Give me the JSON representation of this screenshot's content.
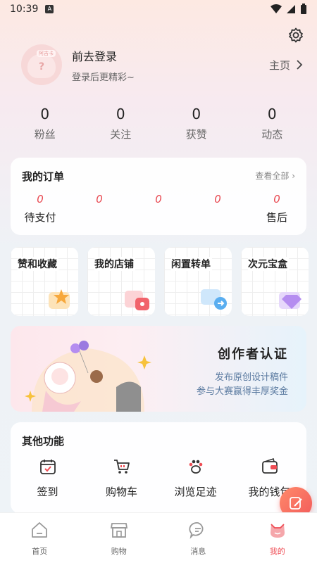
{
  "status": {
    "time": "10:39",
    "sim": "A"
  },
  "profile": {
    "login": "前去登录",
    "sub": "登录后更精彩~",
    "home": "主页",
    "avatar_tag": "阿吉卡"
  },
  "stats": [
    {
      "num": "0",
      "label": "粉丝"
    },
    {
      "num": "0",
      "label": "关注"
    },
    {
      "num": "0",
      "label": "获赞"
    },
    {
      "num": "0",
      "label": "动态"
    }
  ],
  "orders": {
    "title": "我的订单",
    "view_all": "查看全部",
    "items": [
      {
        "count": "0",
        "label": "待支付"
      },
      {
        "count": "0",
        "label": ""
      },
      {
        "count": "0",
        "label": ""
      },
      {
        "count": "0",
        "label": ""
      },
      {
        "count": "0",
        "label": "售后"
      }
    ]
  },
  "tiles": [
    {
      "label": "赞和收藏",
      "color": "#f7a83c"
    },
    {
      "label": "我的店铺",
      "color": "#f1636b"
    },
    {
      "label": "闲置转单",
      "color": "#5aaef0"
    },
    {
      "label": "次元宝盒",
      "color": "#b58df0"
    }
  ],
  "creator": {
    "title": "创作者认证",
    "line1": "发布原创设计稿件",
    "line2": "参与大赛赢得丰厚奖金"
  },
  "other": {
    "title": "其他功能",
    "items": [
      {
        "label": "签到",
        "icon": "calendar-icon"
      },
      {
        "label": "购物车",
        "icon": "cart-icon"
      },
      {
        "label": "浏览足迹",
        "icon": "paw-icon"
      },
      {
        "label": "我的钱包",
        "icon": "wallet-icon"
      }
    ]
  },
  "tabs": [
    {
      "label": "首页",
      "icon": "home-icon"
    },
    {
      "label": "购物",
      "icon": "shop-icon"
    },
    {
      "label": "消息",
      "icon": "message-icon"
    },
    {
      "label": "我的",
      "icon": "cat-icon",
      "active": true
    }
  ],
  "colors": {
    "accent": "#ef4d55",
    "order_count": "#e8474f"
  }
}
